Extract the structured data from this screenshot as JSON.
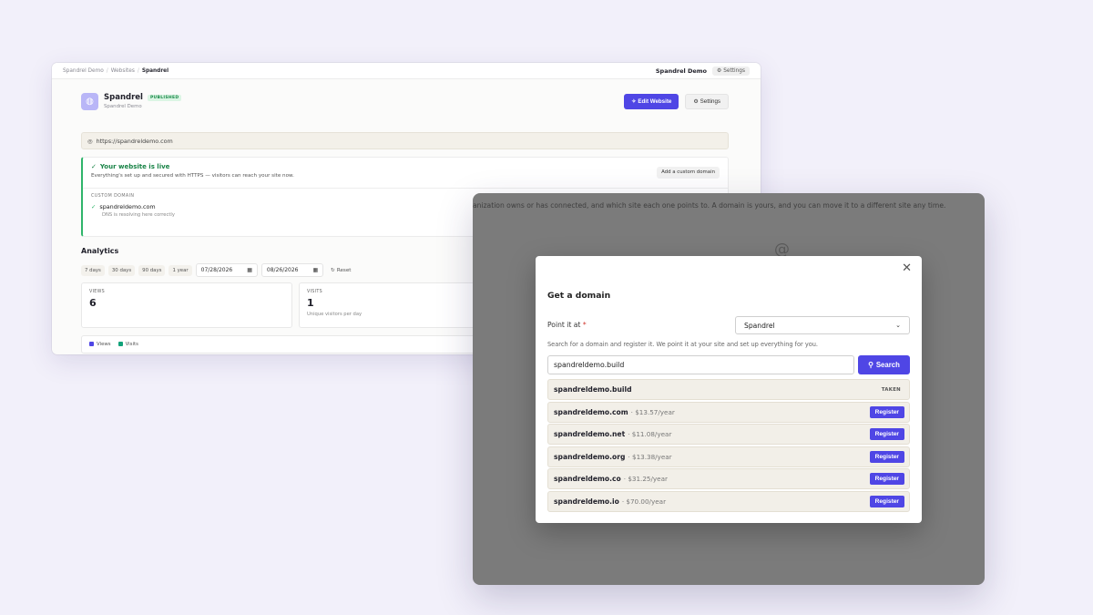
{
  "breadcrumb": [
    "Spandrel Demo",
    "Websites",
    "Spandrel"
  ],
  "topbar": {
    "org": "Spandrel Demo",
    "settings_label": "Settings"
  },
  "site": {
    "name": "Spandrel",
    "status": "PUBLISHED",
    "subtitle": "Spandrel Demo",
    "edit_label": "Edit Website",
    "settings_label": "Settings",
    "url": "https://spandreldemo.com"
  },
  "live": {
    "title": "Your website is live",
    "description": "Everything's set up and secured with HTTPS — visitors can reach your site now.",
    "add_domain_label": "Add a custom domain",
    "custom_domain_label": "CUSTOM DOMAIN",
    "domain": "spandreldemo.com",
    "domain_status": "DNS is resolving here correctly"
  },
  "analytics": {
    "title": "Analytics",
    "ranges": [
      "7 days",
      "30 days",
      "90 days",
      "1 year"
    ],
    "start_date": "07/28/2026",
    "end_date": "08/26/2026",
    "reset_label": "Reset",
    "views_label": "VIEWS",
    "views_value": "6",
    "visits_label": "VISITS",
    "visits_value": "1",
    "visits_sub": "Unique visitors per day",
    "legend": [
      {
        "label": "Views",
        "color": "#4f46e5"
      },
      {
        "label": "Visits",
        "color": "#12a27a"
      }
    ]
  },
  "background_text": "anization owns or has connected, and which site each one points to. A domain is yours, and you can move it to a different site any time.",
  "modal": {
    "title": "Get a domain",
    "point_label": "Point it at",
    "required_mark": "*",
    "selected_site": "Spandrel",
    "help_text": "Search for a domain and register it. We point it at your site and set up everything for you.",
    "search_value": "spandreldemo.build",
    "search_label": "Search",
    "taken_domain": "spandreldemo.build",
    "taken_label": "TAKEN",
    "register_label": "Register",
    "results": [
      {
        "domain": "spandreldemo.com",
        "price": "· $13.57/year"
      },
      {
        "domain": "spandreldemo.net",
        "price": "· $11.08/year"
      },
      {
        "domain": "spandreldemo.org",
        "price": "· $13.38/year"
      },
      {
        "domain": "spandreldemo.co",
        "price": "· $31.25/year"
      },
      {
        "domain": "spandreldemo.io",
        "price": "· $70.00/year"
      }
    ]
  },
  "colors": {
    "accent": "#4f46e5",
    "success": "#188346",
    "backdrop": "#7b7b7b"
  }
}
